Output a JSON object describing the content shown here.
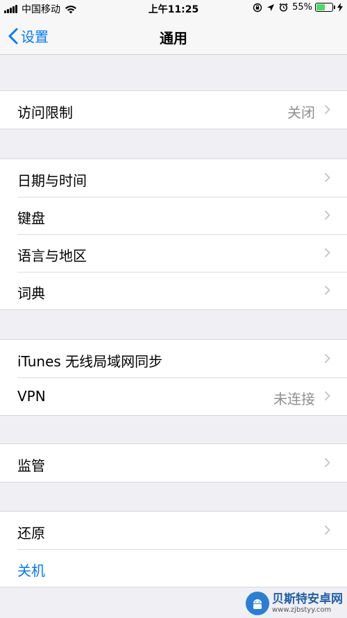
{
  "status_bar": {
    "carrier": "中国移动",
    "time": "上午11:25",
    "battery": "55%",
    "battery_level": 0.55,
    "battery_color": "#4cd964"
  },
  "nav": {
    "back_label": "设置",
    "title": "通用",
    "accent": "#007aff"
  },
  "groups": [
    {
      "rows": [
        {
          "label": "访问限制",
          "value": "关闭"
        }
      ]
    },
    {
      "rows": [
        {
          "label": "日期与时间"
        },
        {
          "label": "键盘"
        },
        {
          "label": "语言与地区"
        },
        {
          "label": "词典"
        }
      ]
    },
    {
      "rows": [
        {
          "label": "iTunes 无线局域网同步"
        },
        {
          "label": "VPN",
          "value": "未连接"
        }
      ]
    },
    {
      "rows": [
        {
          "label": "监管"
        }
      ]
    },
    {
      "rows": [
        {
          "label": "还原"
        },
        {
          "label": "关机"
        }
      ]
    }
  ],
  "watermark": {
    "name": "贝斯特安卓网",
    "url": "www.zjbstyy.com"
  }
}
